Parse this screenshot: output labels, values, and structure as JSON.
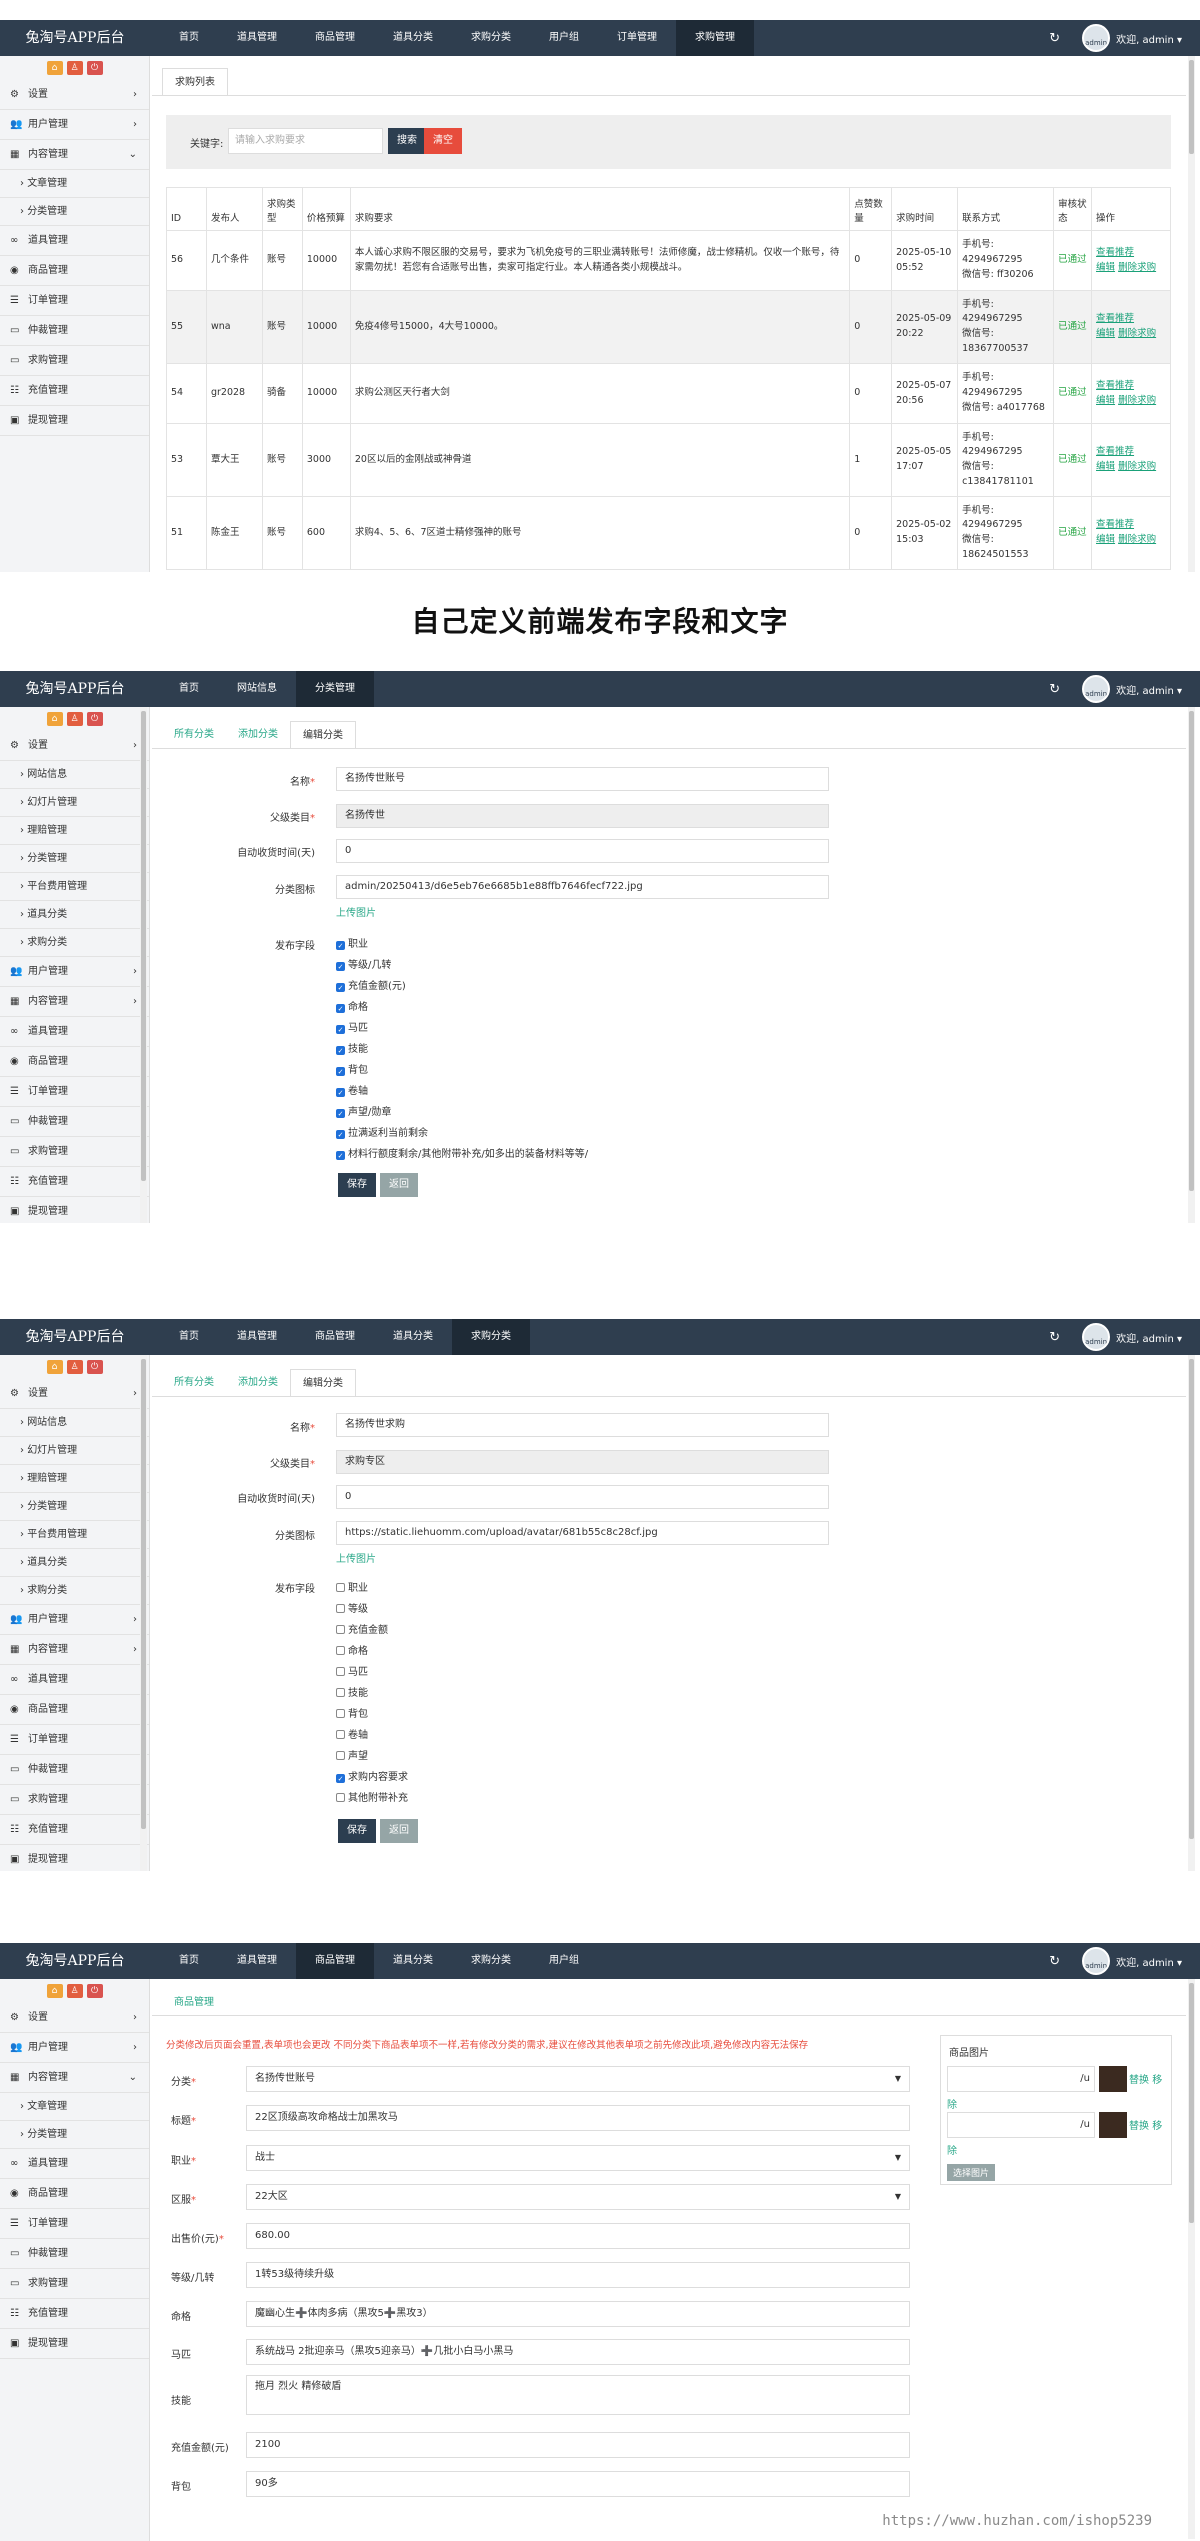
{
  "common": {
    "logo": "兔淘号APP后台",
    "welcome": "欢迎, admin ▾",
    "avatar_label": "admin",
    "refresh_icon": "↻",
    "sidebar_buttons": [
      "⌂",
      "♙",
      "⏻"
    ],
    "accent_color": "#2aa889",
    "topbar_color": "#2f3e4f"
  },
  "heading": "自己定义前端发布字段和文字",
  "panel1": {
    "nav": [
      "首页",
      "道具管理",
      "商品管理",
      "道具分类",
      "求购分类",
      "用户组",
      "订单管理",
      "求购管理"
    ],
    "sidebar": {
      "settings": "设置",
      "users": "用户管理",
      "content": "内容管理",
      "sub_article": "文章管理",
      "sub_category": "分类管理",
      "items": [
        "道具管理",
        "商品管理",
        "订单管理",
        "仲裁管理",
        "求购管理",
        "充值管理",
        "提现管理"
      ]
    },
    "tab": "求购列表",
    "search_label": "关键字:",
    "search_placeholder": "请输入求购要求",
    "search_btn": "搜索",
    "clear_btn": "清空",
    "headers": [
      "ID",
      "发布人",
      "求购类型",
      "价格预算",
      "求购要求",
      "点赞数量",
      "求购时间",
      "联系方式",
      "审核状态",
      "操作"
    ],
    "op_view": "查看推荐",
    "op_edit": "编辑",
    "op_delete": "删除求购",
    "rows": [
      {
        "id": "56",
        "user": "几个条件",
        "type": "账号",
        "budget": "10000",
        "req": "本人诚心求购不限区服的交易号，要求为飞机免疫号的三职业满转账号！法师修魔，战士修精机。仅收一个账号，待家需勿扰！若您有合适账号出售，卖家可指定行业。本人精通各类小规模战斗。",
        "likes": "0",
        "time": "2025-05-10 05:52",
        "phone": "手机号: 4294967295",
        "wechat": "微信号: ff30206",
        "status": "已通过"
      },
      {
        "id": "55",
        "user": "wna",
        "type": "账号",
        "budget": "10000",
        "req": "免疫4修号15000，4大号10000。",
        "likes": "0",
        "time": "2025-05-09 20:22",
        "phone": "手机号: 4294967295",
        "wechat": "微信号: 18367700537",
        "status": "已通过"
      },
      {
        "id": "54",
        "user": "gr2028",
        "type": "骑备",
        "budget": "10000",
        "req": "求购公测区天行者大剑",
        "likes": "0",
        "time": "2025-05-07 20:56",
        "phone": "手机号: 4294967295",
        "wechat": "微信号: a4017768",
        "status": "已通过"
      },
      {
        "id": "53",
        "user": "覃大王",
        "type": "账号",
        "budget": "3000",
        "req": "20区以后的金刚战或神骨道",
        "likes": "1",
        "time": "2025-05-05 17:07",
        "phone": "手机号: 4294967295",
        "wechat": "微信号: c13841781101",
        "status": "已通过"
      },
      {
        "id": "51",
        "user": "陈金王",
        "type": "账号",
        "budget": "600",
        "req": "求购4、5、6、7区道士精修强神的账号",
        "likes": "0",
        "time": "2025-05-02 15:03",
        "phone": "手机号: 4294967295",
        "wechat": "微信号: 18624501553",
        "status": "已通过"
      }
    ]
  },
  "panel2": {
    "nav": [
      "首页",
      "网站信息",
      "分类管理"
    ],
    "sidebar": {
      "settings": "设置",
      "subs": [
        "网站信息",
        "幻灯片管理",
        "理赔管理",
        "分类管理",
        "平台费用管理",
        "道具分类",
        "求购分类"
      ],
      "items": [
        "用户管理",
        "内容管理",
        "道具管理",
        "商品管理",
        "订单管理",
        "仲裁管理",
        "求购管理",
        "充值管理",
        "提现管理"
      ]
    },
    "tabs": [
      "所有分类",
      "添加分类",
      "编辑分类"
    ],
    "labels": {
      "name": "名称",
      "parent": "父级类目",
      "auto_days": "自动收货时间(天)",
      "icon": "分类图标",
      "fields": "发布字段"
    },
    "name": "名扬传世账号",
    "parent": "名扬传世",
    "auto_days": "0",
    "icon_path": "admin/20250413/d6e5eb76e6685b1e88ffb7646fecf722.jpg",
    "upload": "上传图片",
    "fields": [
      "职业",
      "等级/几转",
      "充值金额(元)",
      "命格",
      "马匹",
      "技能",
      "背包",
      "卷轴",
      "声望/勋章",
      "拉满返利当前剩余",
      "材料行额度剩余/其他附带补充/如多出的装备材料等等/"
    ],
    "save": "保存",
    "back": "返回"
  },
  "panel3": {
    "nav": [
      "首页",
      "道具管理",
      "商品管理",
      "道具分类",
      "求购分类"
    ],
    "sidebar": {
      "settings": "设置",
      "subs": [
        "网站信息",
        "幻灯片管理",
        "理赔管理",
        "分类管理",
        "平台费用管理",
        "道具分类",
        "求购分类"
      ],
      "items": [
        "用户管理",
        "内容管理",
        "道具管理",
        "商品管理",
        "订单管理",
        "仲裁管理",
        "求购管理",
        "充值管理",
        "提现管理"
      ]
    },
    "tabs": [
      "所有分类",
      "添加分类",
      "编辑分类"
    ],
    "labels": {
      "name": "名称",
      "parent": "父级类目",
      "auto_days": "自动收货时间(天)",
      "icon": "分类图标",
      "fields": "发布字段"
    },
    "name": "名扬传世求购",
    "parent": "求购专区",
    "auto_days": "0",
    "icon_path": "https://static.liehuomm.com/upload/avatar/681b55c8c28cf.jpg",
    "upload": "上传图片",
    "fields": [
      {
        "label": "职业",
        "checked": false
      },
      {
        "label": "等级",
        "checked": false
      },
      {
        "label": "充值金额",
        "checked": false
      },
      {
        "label": "命格",
        "checked": false
      },
      {
        "label": "马匹",
        "checked": false
      },
      {
        "label": "技能",
        "checked": false
      },
      {
        "label": "背包",
        "checked": false
      },
      {
        "label": "卷轴",
        "checked": false
      },
      {
        "label": "声望",
        "checked": false
      },
      {
        "label": "求购内容要求",
        "checked": true
      },
      {
        "label": "其他附带补充",
        "checked": false
      }
    ],
    "save": "保存",
    "back": "返回"
  },
  "panel4": {
    "nav": [
      "首页",
      "道具管理",
      "商品管理",
      "道具分类",
      "求购分类",
      "用户组"
    ],
    "sidebar": {
      "settings": "设置",
      "users": "用户管理",
      "content": "内容管理",
      "sub_article": "文章管理",
      "sub_category": "分类管理",
      "items": [
        "道具管理",
        "商品管理",
        "订单管理",
        "仲裁管理",
        "求购管理",
        "充值管理",
        "提现管理"
      ]
    },
    "tab": "商品管理",
    "warning": "分类修改后页面会重置,表单项也会更改 不同分类下商品表单项不一样,若有修改分类的需求,建议在修改其他表单项之前先修改此项,避免修改内容无法保存",
    "fields": [
      {
        "label": "分类",
        "req": true,
        "value": "名扬传世账号",
        "select": true
      },
      {
        "label": "标题",
        "req": true,
        "value": "22区顶级高攻命格战士加黑攻马",
        "select": false
      },
      {
        "label": "职业",
        "req": true,
        "value": "战士",
        "select": true
      },
      {
        "label": "区服",
        "req": true,
        "value": "22大区",
        "select": true
      },
      {
        "label": "出售价(元)",
        "req": true,
        "value": "680.00",
        "select": false
      },
      {
        "label": "等级/几转",
        "req": false,
        "value": "1转53级待续升级",
        "select": false
      },
      {
        "label": "命格",
        "req": false,
        "value": "魔幽心生➕体肉多病（黑攻5➕黑攻3）",
        "select": false
      },
      {
        "label": "马匹",
        "req": false,
        "value": "系统战马  2批迎亲马（黑攻5迎亲马）➕几批小白马小黑马",
        "select": false
      },
      {
        "label": "技能",
        "req": false,
        "value": "拖月  烈火  精修破盾",
        "select": false
      },
      {
        "label": "充值金额(元)",
        "req": false,
        "value": "2100",
        "select": false
      },
      {
        "label": "背包",
        "req": false,
        "value": "90多",
        "select": false
      }
    ],
    "images_title": "商品图片",
    "image_suffix": "/u",
    "image_links": [
      "替换",
      "移",
      "除"
    ],
    "select_image": "选择图片",
    "watermark": "https://www.huzhan.com/ishop5239"
  }
}
